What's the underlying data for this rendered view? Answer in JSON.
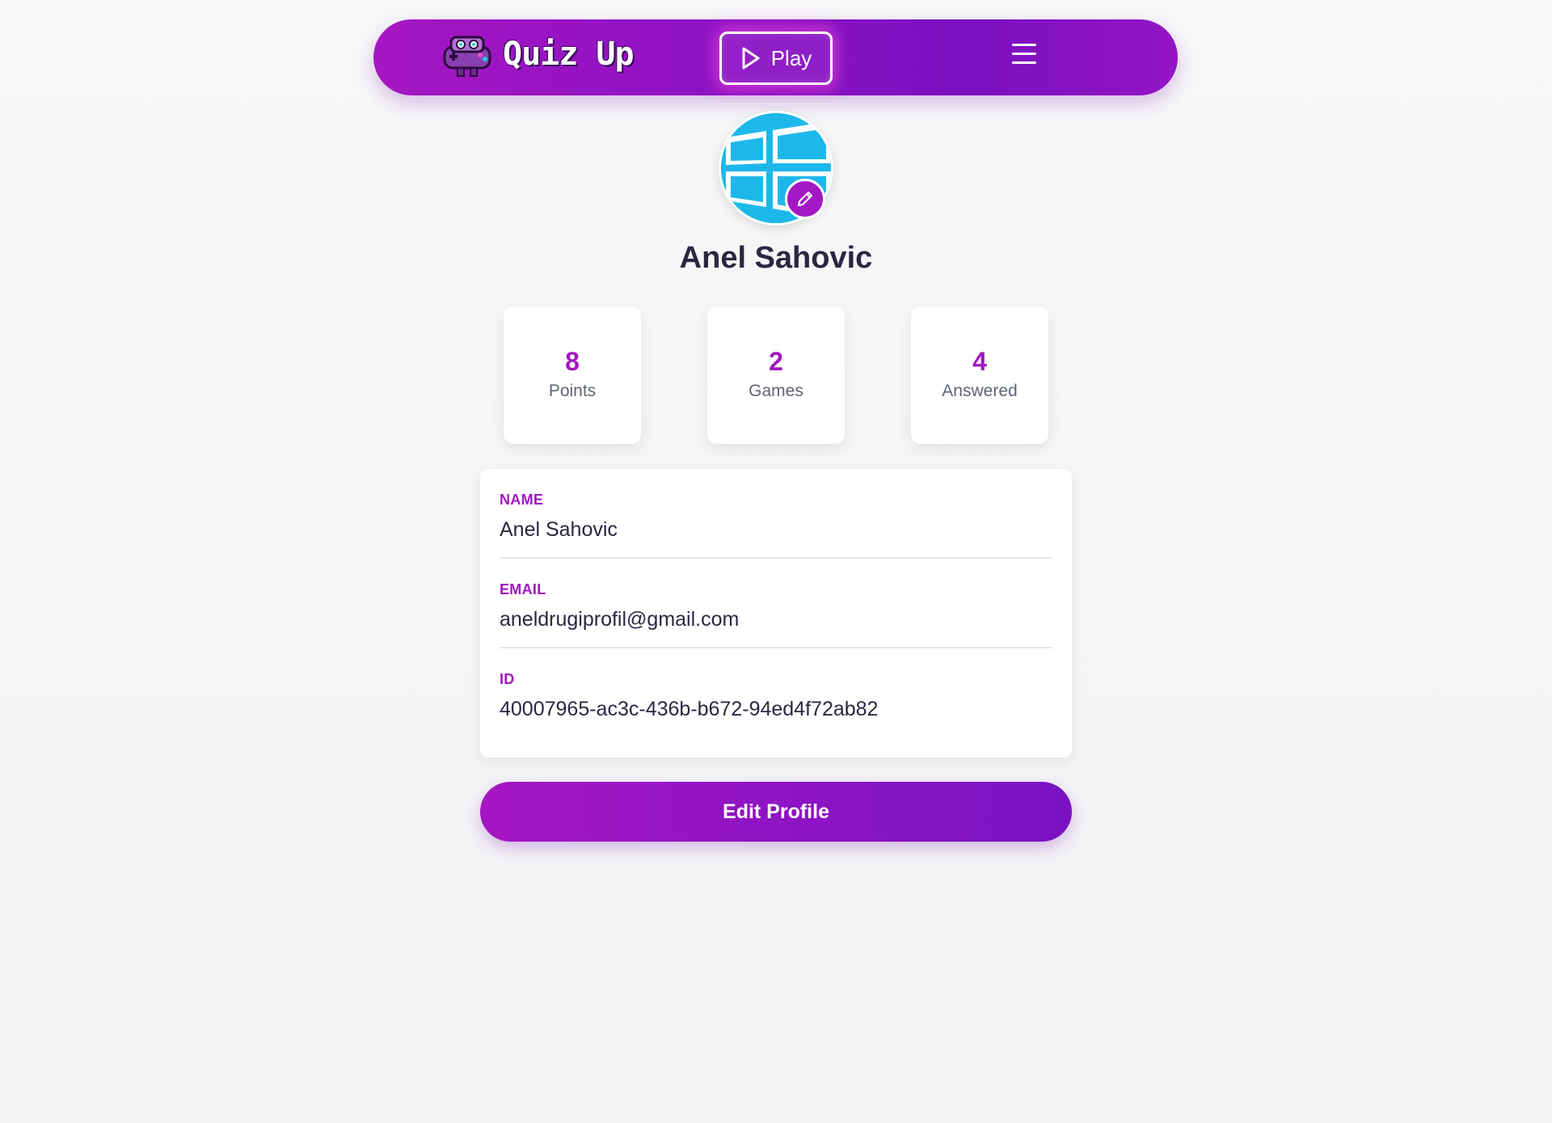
{
  "navbar": {
    "logo_text": "Quiz Up",
    "play_label": "Play",
    "mascot_icon": "gamepad-mascot-icon",
    "menu_icon": "hamburger-menu-icon"
  },
  "profile": {
    "name": "Anel Sahovic",
    "avatar_icon": "windows-logo-avatar",
    "edit_avatar_icon": "pencil-icon"
  },
  "stats": [
    {
      "value": "8",
      "label": "Points"
    },
    {
      "value": "2",
      "label": "Games"
    },
    {
      "value": "4",
      "label": "Answered"
    }
  ],
  "details": [
    {
      "label": "NAME",
      "value": "Anel Sahovic"
    },
    {
      "label": "EMAIL",
      "value": "aneldrugiprofil@gmail.com"
    },
    {
      "label": "ID",
      "value": "40007965-ac3c-436b-b672-94ed4f72ab82"
    }
  ],
  "edit_profile_label": "Edit Profile",
  "colors": {
    "accent": "#a018be",
    "nav_gradient_start": "#a516c2",
    "nav_gradient_end": "#7b10c0",
    "avatar_blue": "#1db8ea"
  }
}
